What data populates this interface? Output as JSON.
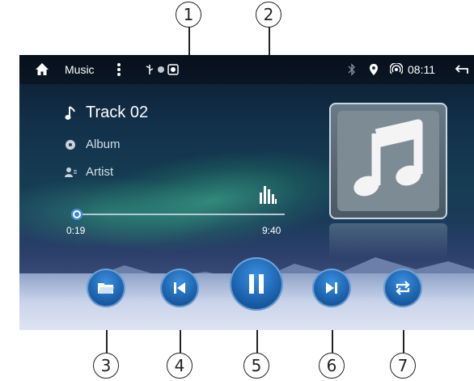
{
  "callouts": [
    "1",
    "2",
    "3",
    "4",
    "5",
    "6",
    "7"
  ],
  "statusbar": {
    "app_title": "Music",
    "time": "08:11"
  },
  "track": {
    "title": "Track 02",
    "album": "Album",
    "artist": "Artist"
  },
  "progress": {
    "elapsed": "0:19",
    "total": "9:40",
    "fraction": 0.033
  },
  "icons": {
    "home": "home-icon",
    "menu": "more-vert-icon",
    "usb": "usb-icon",
    "bluetooth": "bluetooth-icon",
    "location": "location-icon",
    "signal": "signal-icon",
    "back": "back-icon",
    "note": "music-note-icon",
    "album": "album-disc-icon",
    "artist": "artist-icon",
    "eq": "equalizer-icon",
    "folder": "folder-icon",
    "prev": "previous-icon",
    "pause": "pause-icon",
    "next": "next-icon",
    "repeat": "repeat-icon"
  },
  "colors": {
    "accent": "#1a5fa8",
    "seek": "#3b88d8"
  }
}
